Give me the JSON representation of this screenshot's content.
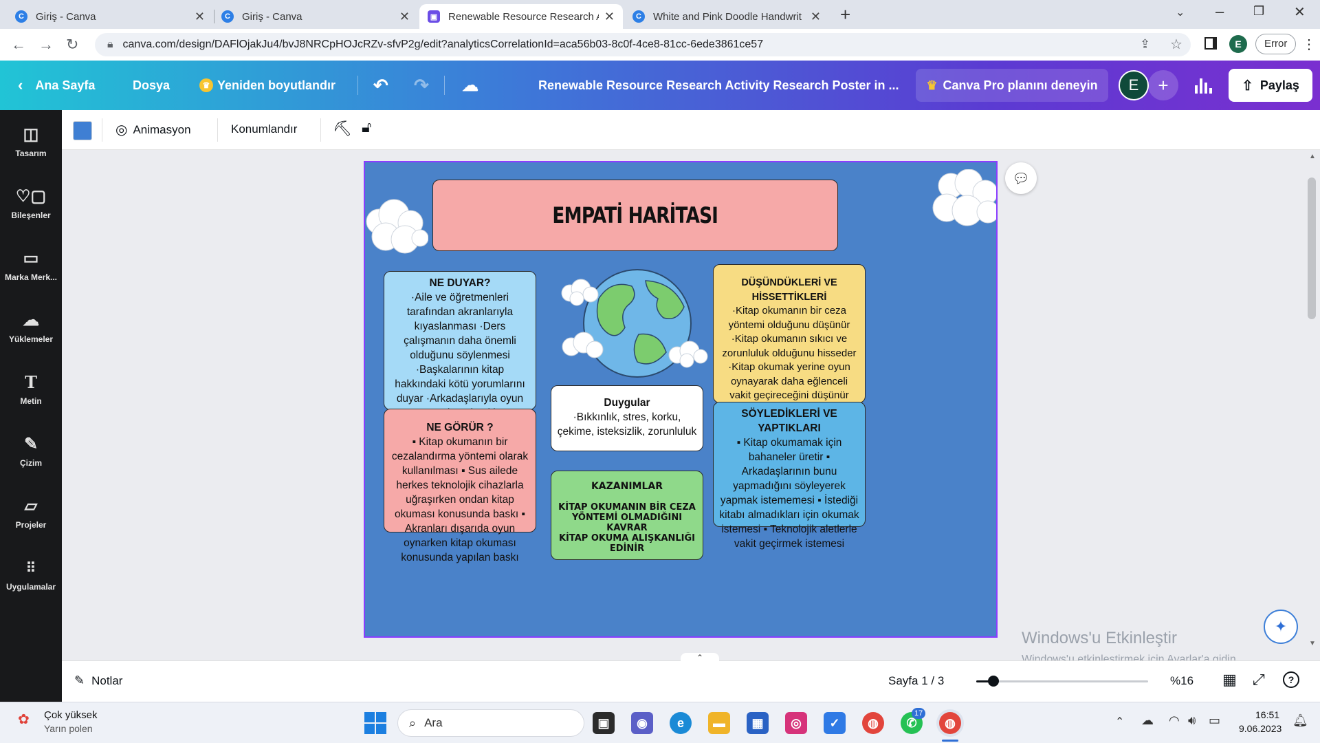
{
  "browser": {
    "tabs": [
      {
        "title": "Giriş - Canva",
        "active": false
      },
      {
        "title": "Giriş - Canva",
        "active": false
      },
      {
        "title": "Renewable Resource Research Ac",
        "active": true
      },
      {
        "title": "White and Pink Doodle Handwrit",
        "active": false
      }
    ],
    "url": "canva.com/design/DAFlOjakJu4/bvJ8NRCpHOJcRZv-sfvP2g/edit?analyticsCorrelationId=aca56b03-8c0f-4ce8-81cc-6ede3861ce57",
    "profile_initial": "E",
    "error_label": "Error"
  },
  "canva_header": {
    "home": "Ana Sayfa",
    "file": "Dosya",
    "resize": "Yeniden boyutlandır",
    "doc_title": "Renewable Resource Research Activity Research Poster in ...",
    "pro_cta": "Canva Pro planını deneyin",
    "avatar_initial": "E",
    "share": "Paylaş"
  },
  "sidebar": {
    "items": [
      {
        "label": "Tasarım",
        "icon": "layout-icon"
      },
      {
        "label": "Bileşenler",
        "icon": "elements-icon"
      },
      {
        "label": "Marka Merk...",
        "icon": "brand-icon"
      },
      {
        "label": "Yüklemeler",
        "icon": "upload-icon"
      },
      {
        "label": "Metin",
        "icon": "text-icon"
      },
      {
        "label": "Çizim",
        "icon": "draw-icon"
      },
      {
        "label": "Projeler",
        "icon": "folder-icon"
      },
      {
        "label": "Uygulamalar",
        "icon": "apps-icon"
      }
    ]
  },
  "toolbar": {
    "color": "#3f7fd3",
    "animate": "Animasyon",
    "position": "Konumlandır"
  },
  "poster": {
    "title": "EMPATİ HARİTASI",
    "hears": {
      "heading": "NE DUYAR?",
      "body": "·Aile ve öğretmenleri tarafından akranlarıyla kıyaslanması ·Ders çalışmanın daha önemli olduğunu söylenmesi ·Başkalarının kitap hakkındaki kötü yorumlarını duyar ·Arkadaşlarıyla oyun oynamak yerine kitap okuması gerektiğini duyar"
    },
    "sees": {
      "heading": "NE GÖRÜR ?",
      "body": "▪ Kitap okumanın bir cezalandırma yöntemi olarak kullanılması ▪ Sus ailede herkes teknolojik cihazlarla uğraşırken ondan kitap okuması konusunda baskı ▪ Akranları dışarıda oyun oynarken kitap okuması konusunda yapılan baskı"
    },
    "thinks": {
      "heading": "DÜŞÜNDÜKLERİ VE HİSSETTİKLERİ",
      "body": "·Kitap okumanın bir ceza yöntemi olduğunu düşünür ·Kitap okumanın sıkıcı ve zorunluluk olduğunu hisseder ·Kitap okumak yerine oyun oynayarak daha eğlenceli vakit geçireceğini düşünür ·Kitap okumamak yüzünden başkalarıyla kıyaslandığında düşünür"
    },
    "says": {
      "heading": "SÖYLEDİKLERİ VE YAPTIKLARI",
      "body": "▪ Kitap okumamak için bahaneler üretir ▪ Arkadaşlarının bunu yapmadığını söyleyerek yapmak istememesi ▪ İstediği kitabı almadıkları için okumak istemesi ▪ Teknolojik aletlerle vakit geçirmek istemesi"
    },
    "feelings": {
      "heading": "Duygular",
      "body": "·Bıkkınlık, stres, korku, çekime, isteksizlik, zorunluluk"
    },
    "gains": {
      "heading": "KAZANIMLAR",
      "line1": "KİTAP OKUMANIN BİR CEZA YÖNTEMİ OLMADIĞINI KAVRAR",
      "line2": "KİTAP OKUMA ALIŞKANLIĞI EDİNİR"
    },
    "colors": {
      "background": "#4a82c9",
      "title_box": "#f6a9a8",
      "hears": "#a5daf7",
      "sees": "#f6a9a8",
      "thinks": "#f7dc83",
      "says": "#5db5e6",
      "feelings": "#ffffff",
      "gains": "#8fd98a"
    }
  },
  "watermark": {
    "title": "Windows'u Etkinleştir",
    "subtitle": "Windows'u etkinleştirmek için Ayarlar'a gidin."
  },
  "bottombar": {
    "notes": "Notlar",
    "page": "Sayfa 1 / 3",
    "zoom": "%16",
    "zoom_fraction": 0.1
  },
  "taskbar": {
    "weather_title": "Çok yüksek",
    "weather_sub": "Yarın polen",
    "search": "Ara",
    "time": "16:51",
    "date": "9.06.2023",
    "badge_teams": "17"
  }
}
